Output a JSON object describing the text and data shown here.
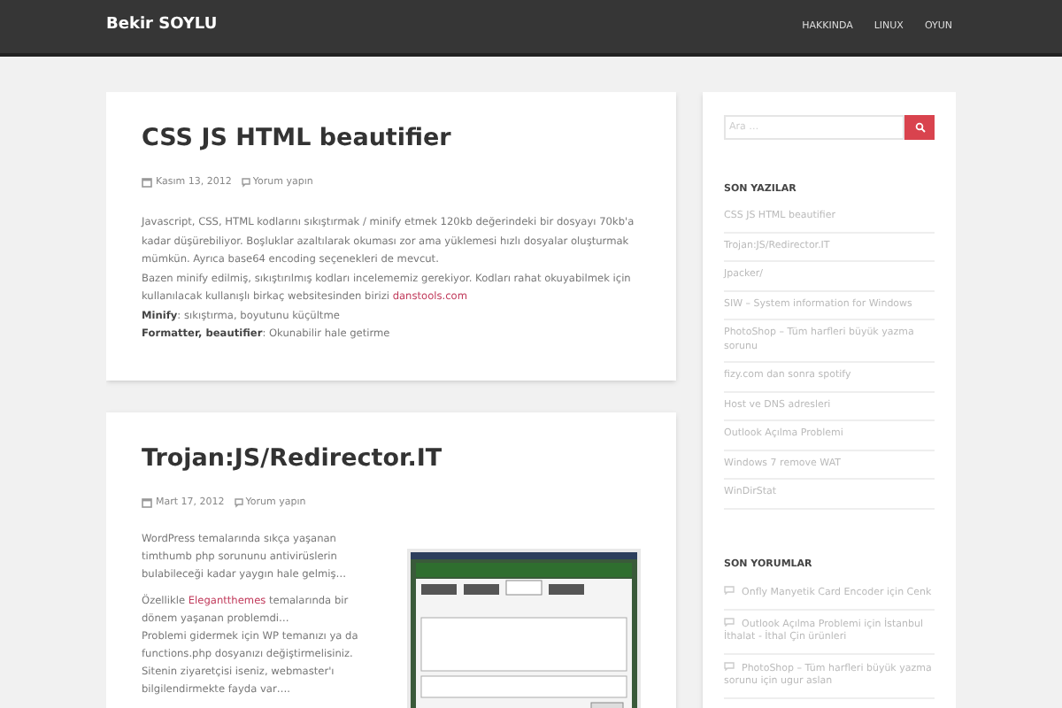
{
  "header": {
    "site_title": "Bekir SOYLU",
    "nav": [
      "HAKKINDA",
      "LINUX",
      "OYUN"
    ]
  },
  "posts": [
    {
      "title": "CSS JS HTML beautifier",
      "date": "Kasım 13, 2012",
      "comments": "Yorum yapın",
      "paragraphs": [
        {
          "text": "Javascript, CSS, HTML kodlarını sıkıştırmak / minify etmek 120kb değerindeki bir dosyayı 70kb'a kadar düşürebiliyor. Boşluklar azaltılarak okuması zor ama yüklemesi hızlı dosyalar oluşturmak mümkün. Ayrıca base64 encoding seçenekleri de mevcut."
        },
        {
          "text": "Bazen minify edilmiş, sıkıştırılmış kodları incelememiz gerekiyor. Kodları rahat okuyabilmek için kullanılacak kullanışlı birkaç websitesinden birizi ",
          "link": "danstools.com"
        },
        {
          "text": "**Minify**: sıkıştırma, boyutunu küçültme"
        },
        {
          "text": "**Formatter, beautifier**: Okunabilir hale getirme"
        }
      ]
    },
    {
      "title": "Trojan:JS/Redirector.IT",
      "date": "Mart 17, 2012",
      "comments": "Yorum yapın",
      "image": true,
      "paragraphs": [
        {
          "text": "WordPress temalarında sıkça yaşanan timthumb php sorununu antivirüslerin bulabileceği kadar yaygın hale gelmiş…",
          "gap": true
        },
        {
          "text": "Özellikle ",
          "link": "Elegantthemes",
          "after": " temalarında bir dönem yaşanan problemdi…"
        },
        {
          "text": "Problemi gidermek için WP temanızı ya da functions.php dosyanızı değiştirmelisiniz."
        },
        {
          "text": "Sitenin ziyaretçisi iseniz, webmaster'ı bilgilendirmekte fayda var…."
        }
      ]
    }
  ],
  "sidebar": {
    "search": {
      "placeholder": "Ara …"
    },
    "recent_posts": {
      "title": "SON YAZILAR",
      "items": [
        "CSS JS HTML beautifier",
        "Trojan:JS/Redirector.IT",
        "Jpacker/",
        "SIW – System information for Windows",
        "PhotoShop – Tüm harfleri büyük yazma sorunu",
        "fizy.com dan sonra spotify",
        "Host ve DNS adresleri",
        "Outlook Açılma Problemi",
        "Windows 7 remove WAT",
        "WinDirStat"
      ]
    },
    "recent_comments": {
      "title": "SON YORUMLAR",
      "items": [
        "Onfly Manyetik Card Encoder için Cenk",
        "Outlook Açılma Problemi için İstanbul İthalat - İthal Çin ürünleri",
        "PhotoShop – Tüm harfleri büyük yazma sorunu için ugur aslan"
      ]
    }
  }
}
